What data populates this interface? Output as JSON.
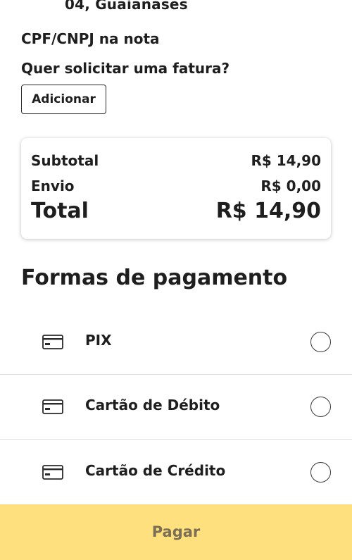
{
  "address": {
    "partial_line": "04, Guaianases"
  },
  "cpf": {
    "title": "CPF/CNPJ na nota",
    "question": "Quer solicitar uma fatura?",
    "add_button": "Adicionar"
  },
  "summary": {
    "subtotal_label": "Subtotal",
    "subtotal_value": "R$ 14,90",
    "shipping_label": "Envio",
    "shipping_value": "R$ 0,00",
    "total_label": "Total",
    "total_value": "R$ 14,90"
  },
  "payment": {
    "title": "Formas de pagamento",
    "options": [
      {
        "label": "PIX",
        "icon": "card-icon",
        "selected": false
      },
      {
        "label": "Cartão de Débito",
        "icon": "card-icon",
        "selected": false
      },
      {
        "label": "Cartão de Crédito",
        "icon": "card-icon",
        "selected": false
      }
    ]
  },
  "footer": {
    "pay_button": "Pagar"
  },
  "colors": {
    "pay_button_bg": "#ffe07e",
    "pay_button_text": "#7a6e53",
    "text": "#1e1e1e"
  }
}
